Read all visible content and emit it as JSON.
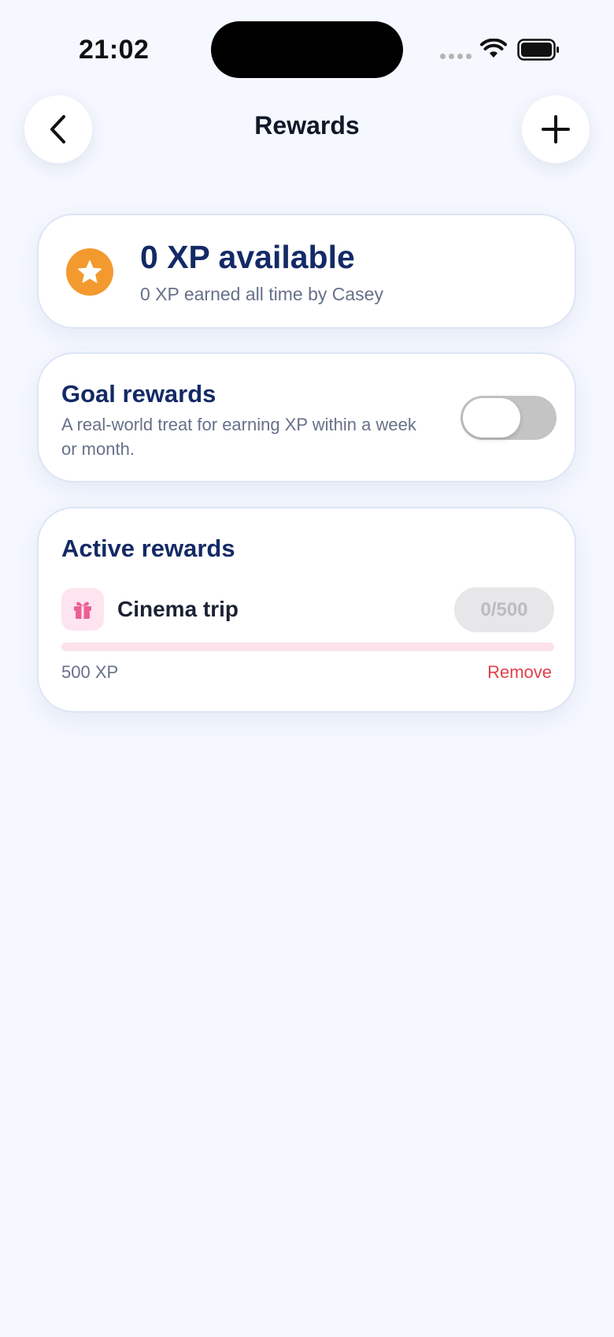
{
  "status_bar": {
    "time": "21:02"
  },
  "header": {
    "title": "Rewards",
    "back_icon": "chevron-left-icon",
    "add_icon": "plus-icon"
  },
  "xp_summary": {
    "title": "0 XP available",
    "subtitle": "0 XP earned all time by Casey",
    "icon": "star-icon",
    "icon_color": "#f39a2f"
  },
  "goal_rewards": {
    "title": "Goal rewards",
    "description": "A real-world treat for earning XP within a week or month.",
    "enabled": false
  },
  "active_rewards": {
    "title": "Active rewards",
    "items": [
      {
        "name": "Cinema trip",
        "icon": "gift-icon",
        "progress_label": "0/500",
        "progress_fraction": 0,
        "cost": "500 XP",
        "remove_label": "Remove"
      }
    ]
  },
  "colors": {
    "background": "#f5f8fe",
    "heading": "#142a66",
    "accent_pink": "#f06c94",
    "danger": "#e0434c"
  }
}
